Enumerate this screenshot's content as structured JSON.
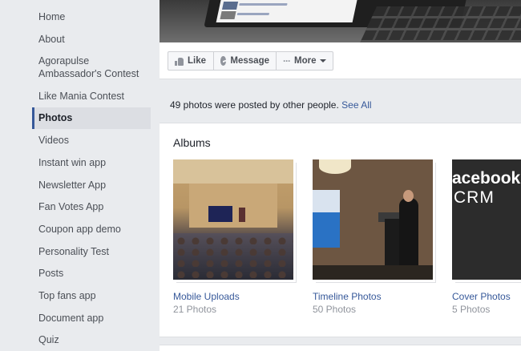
{
  "sidebar": {
    "items": [
      {
        "label": "Home"
      },
      {
        "label": "About"
      },
      {
        "label": "Agorapulse Ambassador's Contest"
      },
      {
        "label": "Like Mania Contest"
      },
      {
        "label": "Photos",
        "active": true
      },
      {
        "label": "Videos"
      },
      {
        "label": "Instant win app"
      },
      {
        "label": "Newsletter App"
      },
      {
        "label": "Fan Votes App"
      },
      {
        "label": "Coupon app demo"
      },
      {
        "label": "Personality Test"
      },
      {
        "label": "Posts"
      },
      {
        "label": "Top fans app"
      },
      {
        "label": "Document app"
      },
      {
        "label": "Quiz"
      }
    ]
  },
  "actions": {
    "like_label": "Like",
    "message_label": "Message",
    "more_label": "More"
  },
  "info": {
    "text": "49 photos were posted by other people.",
    "link": "See All"
  },
  "albums": {
    "title": "Albums",
    "items": [
      {
        "name": "Mobile Uploads",
        "count": "21 Photos"
      },
      {
        "name": "Timeline Photos",
        "count": "50 Photos"
      },
      {
        "name": "Cover Photos",
        "count": "5 Photos"
      }
    ],
    "cover_text_line1": "acebook",
    "cover_text_line2": "CRM"
  },
  "colors": {
    "link": "#365899",
    "active_border": "#365899",
    "background": "#e9ebee"
  }
}
